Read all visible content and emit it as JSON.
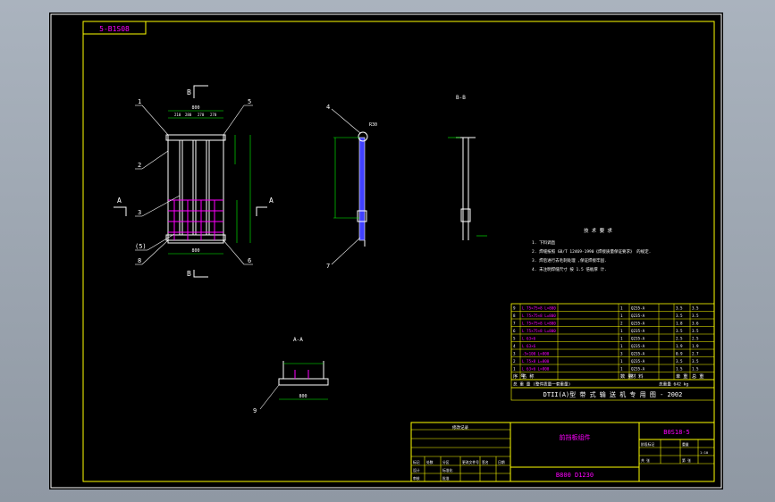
{
  "drawing_code": "5-B1S08",
  "views": {
    "section_bb_top": "B",
    "section_bb_bottom": "B",
    "section_aa_left": "A",
    "section_aa_right": "A",
    "side_view_title": "B-B",
    "section_aa_title": "A-A"
  },
  "leaders": {
    "front": [
      "1",
      "2",
      "3",
      "(5)",
      "8",
      "5",
      "6"
    ],
    "side": [
      "4",
      "7"
    ],
    "aa": [
      "9"
    ]
  },
  "dimensions": {
    "top_total": "800",
    "top_parts": [
      "210",
      "280",
      "270",
      "270"
    ],
    "bottom_width": "800",
    "aa_bottom": "800",
    "radius": "R30"
  },
  "notes": {
    "title": "技 术 要 求",
    "items": [
      "1. 下料调直",
      "2. 焊缝按照 GB/T 12469-1990《焊接质量保证要求》 的规定.",
      "3. 焊后进行去毛刺处理 ,保证焊接牢固.",
      "4. 未注明焊缝尺寸 按 1.5 倍板厚 计."
    ]
  },
  "bom": {
    "rows": [
      [
        "9",
        "L 75×75×8 L=800",
        "1",
        "Q235-A",
        "3.5",
        "3.5"
      ],
      [
        "8",
        "L 75×75×8 L=800",
        "1",
        "Q235-A",
        "3.5",
        "3.5"
      ],
      [
        "7",
        "L 75×75×8 L=800",
        "2",
        "Q235-A",
        "1.8",
        "3.6"
      ],
      [
        "6",
        "L 75×75×8 L=800",
        "1",
        "Q235-A",
        "3.5",
        "3.5"
      ],
      [
        "5",
        "L 63×6",
        "1",
        "Q235-A",
        "2.5",
        "2.5"
      ],
      [
        "4",
        "L 63×6",
        "1",
        "Q235-A",
        "1.9",
        "1.9"
      ],
      [
        "3",
        "-5×100 L=800",
        "3",
        "Q235-A",
        "0.9",
        "2.7"
      ],
      [
        "2",
        "L 75×8 L=800",
        "1",
        "Q235-A",
        "3.5",
        "3.5"
      ],
      [
        "1",
        "L 63×6 L=800",
        "1",
        "Q235-A",
        "1.5",
        "1.5"
      ]
    ],
    "header": [
      "序 号",
      "名  称",
      "数 量",
      "材  料",
      "单 重",
      "总 重"
    ],
    "total_line": "总 重 量 (整件质量一套重量)",
    "total_value": "总重量 642 kg",
    "project_title": "DTII(A)型 带 式 输 送 机 专 用 图 - 2002"
  },
  "title_block": {
    "part_name": "前挡板组件",
    "drawing_number": "B0S18-5",
    "spec": "B800 D1230",
    "rev_header": "修改记录",
    "small_rows": [
      [
        "标记",
        "处数",
        "分区",
        "更改文件号",
        "签名",
        "日期"
      ],
      [
        "设计",
        "",
        "标准化",
        "",
        "阶段标记",
        "重量"
      ],
      [
        "审核",
        "",
        "",
        "",
        "",
        "1:10"
      ],
      [
        "工艺",
        "",
        "批准",
        "",
        "共 张",
        "第 张"
      ]
    ]
  },
  "colors": {
    "line_white": "#ffffff",
    "line_yellow": "#ffff00",
    "line_magenta": "#ff00ff",
    "line_green": "#00ff00",
    "line_blue": "#4040ff",
    "background": "#000000"
  }
}
